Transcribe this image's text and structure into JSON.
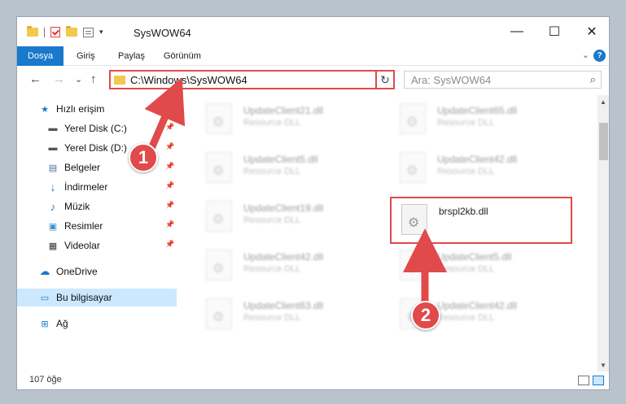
{
  "window": {
    "title": "SysWOW64",
    "minimize_glyph": "—",
    "maximize_glyph": "☐",
    "close_glyph": "✕"
  },
  "ribbon": {
    "tabs": [
      "Dosya",
      "Giriş",
      "Paylaş",
      "Görünüm"
    ],
    "expand_glyph": "⌄",
    "help_glyph": "?"
  },
  "navigation": {
    "back_glyph": "←",
    "forward_glyph": "→",
    "recent_glyph": "⌄",
    "up_glyph": "↑",
    "address_path": "C:\\Windows\\SysWOW64",
    "address_dropdown_glyph": "⌄",
    "refresh_glyph": "↻",
    "search_placeholder": "Ara: SysWOW64",
    "search_glyph": "⌕"
  },
  "sidebar": {
    "items": [
      {
        "label": "Hızlı erişim",
        "icon": "star-icon",
        "pinned": false
      },
      {
        "label": "Yerel Disk (C:)",
        "icon": "drive-icon",
        "pinned": true
      },
      {
        "label": "Yerel Disk (D:)",
        "icon": "drive-icon",
        "pinned": true
      },
      {
        "label": "Belgeler",
        "icon": "documents-icon",
        "pinned": true
      },
      {
        "label": "İndirmeler",
        "icon": "download-icon",
        "pinned": true
      },
      {
        "label": "Müzik",
        "icon": "music-icon",
        "pinned": true
      },
      {
        "label": "Resimler",
        "icon": "pictures-icon",
        "pinned": true
      },
      {
        "label": "Videolar",
        "icon": "video-icon",
        "pinned": true
      },
      {
        "label": "OneDrive",
        "icon": "cloud-icon",
        "pinned": false
      },
      {
        "label": "Bu bilgisayar",
        "icon": "computer-icon",
        "pinned": false
      },
      {
        "label": "Ağ",
        "icon": "network-icon",
        "pinned": false
      }
    ],
    "pin_glyph": "📌"
  },
  "files": {
    "left": [
      {
        "name": "UpdateClient21.dll",
        "desc": "Resource DLL"
      },
      {
        "name": "UpdateClient5.dll",
        "desc": "Resource DLL"
      },
      {
        "name": "UpdateClient19.dll",
        "desc": "Resource DLL"
      },
      {
        "name": "UpdateClient42.dll",
        "desc": "Resource DLL"
      },
      {
        "name": "UpdateClient63.dll",
        "desc": "Resource DLL"
      }
    ],
    "right": [
      {
        "name": "UpdateClient65.dll",
        "desc": "Resource DLL"
      },
      {
        "name": "UpdateClient42.dll",
        "desc": "Resource DLL"
      },
      {
        "name": "brspl2kb.dll",
        "desc": ""
      },
      {
        "name": "UpdateClient5.dll",
        "desc": "Resource DLL"
      },
      {
        "name": "UpdateClient42.dll",
        "desc": "Resource DLL"
      }
    ]
  },
  "status": {
    "item_count": "107 öğe"
  },
  "annotations": {
    "step1": "1",
    "step2": "2"
  },
  "colors": {
    "accent": "#1979ca",
    "highlight": "#e04a4a"
  }
}
